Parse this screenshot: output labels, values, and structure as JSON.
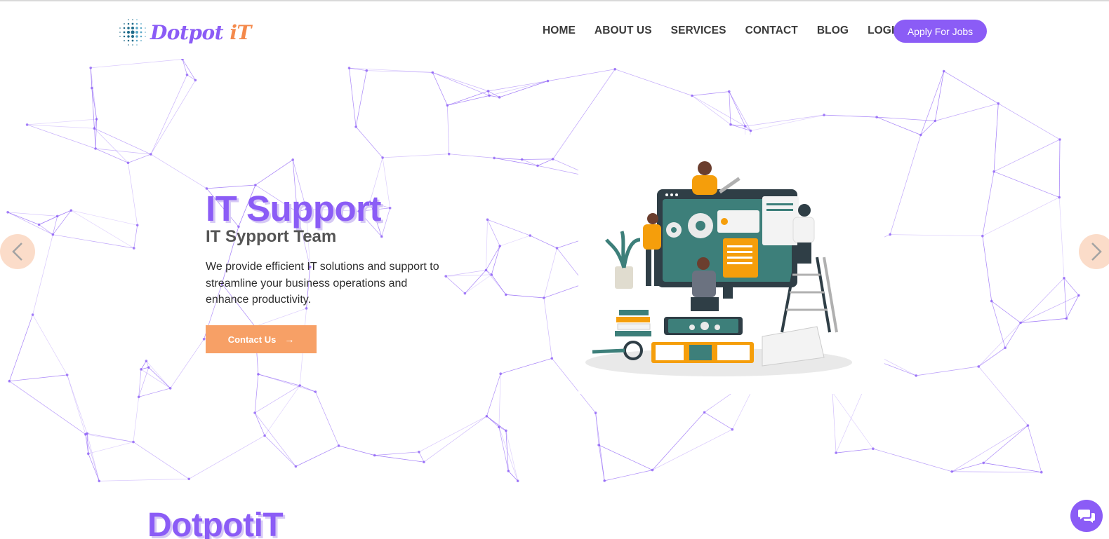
{
  "brand": {
    "name_part1": "Dotpot",
    "name_part2": "iT",
    "primary_color": "#8b5cf6",
    "accent_color": "#f4894b"
  },
  "nav": {
    "items": [
      {
        "label": "HOME",
        "icon": ""
      },
      {
        "label": "ABOUT US",
        "icon": ""
      },
      {
        "label": "SERVICES",
        "icon": ""
      },
      {
        "label": "CONTACT",
        "icon": ""
      },
      {
        "label": "BLOG",
        "icon": ""
      },
      {
        "label": "LOGIN",
        "icon": ""
      }
    ],
    "cta_label": "Apply For Jobs"
  },
  "hero": {
    "title": "IT Support",
    "subtitle": "IT Sypport Team",
    "description": "We provide efficient IT solutions and support to streamline your business operations and enhance productivity.",
    "button_label": "Contact Us",
    "button_icon": "arrow-right-icon",
    "illustration": "it-team-illustration"
  },
  "carousel": {
    "prev_icon": "chevron-left-icon",
    "next_icon": "chevron-right-icon"
  },
  "section": {
    "title": "DotpotiT"
  },
  "chat": {
    "icon": "chat-bubbles-icon"
  }
}
